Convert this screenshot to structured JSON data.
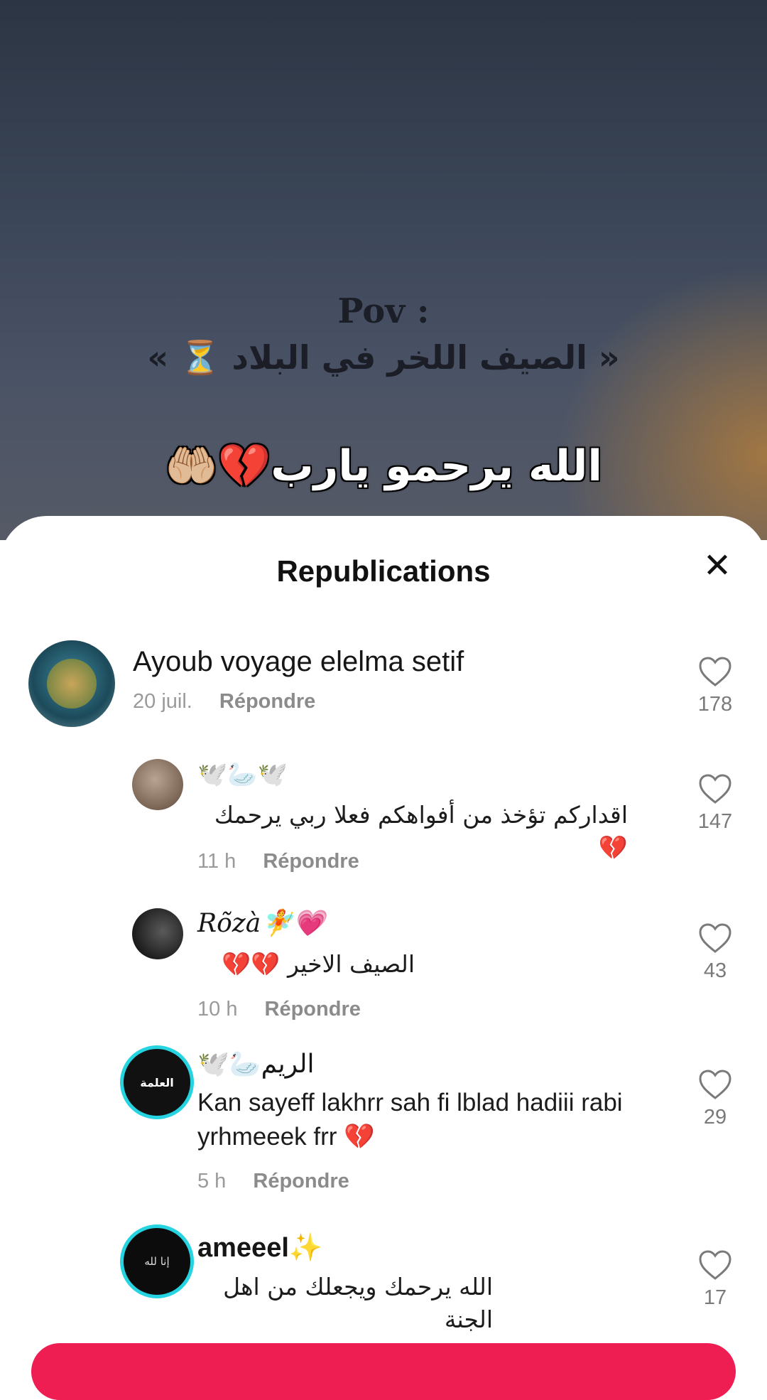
{
  "video": {
    "pov_line1": "Pov :",
    "pov_line2": "« الصيف اللخر في البلاد ⏳ »",
    "caption": "الله يرحمو يارب💔🤲🏼"
  },
  "sheet": {
    "title": "Republications",
    "close_icon": "close-icon"
  },
  "comments": [
    {
      "username": "Ayoub voyage elelma setif",
      "text": "",
      "time": "20 juil.",
      "reply": "Répondre",
      "likes": "178"
    },
    {
      "username": "🕊️🦢🕊️",
      "text": "اقداركم تؤخذ من أفواهكم فعلا ربي يرحمك 💔",
      "time": "11 h",
      "reply": "Répondre",
      "likes": "147"
    },
    {
      "username": "Rõzà🧚💗",
      "text": "الصيف الاخير 💔💔",
      "time": "10 h",
      "reply": "Répondre",
      "likes": "43"
    },
    {
      "username": "الريم🦢🕊️",
      "text": "Kan sayeff lakhrr sah fi lblad hadiii rabi yrhmeeek frr 💔",
      "time": "5 h",
      "reply": "Répondre",
      "likes": "29"
    },
    {
      "username": "ameeel✨",
      "text": "الله يرحمك ويجعلك من اهل الجنة",
      "time": "",
      "reply": "",
      "likes": "17"
    }
  ],
  "avatar_labels": {
    "a1": "",
    "a4": "العلمة",
    "a5": "إنا لله"
  },
  "colors": {
    "accent": "#ee1d52",
    "ring": "#25d4e0"
  }
}
